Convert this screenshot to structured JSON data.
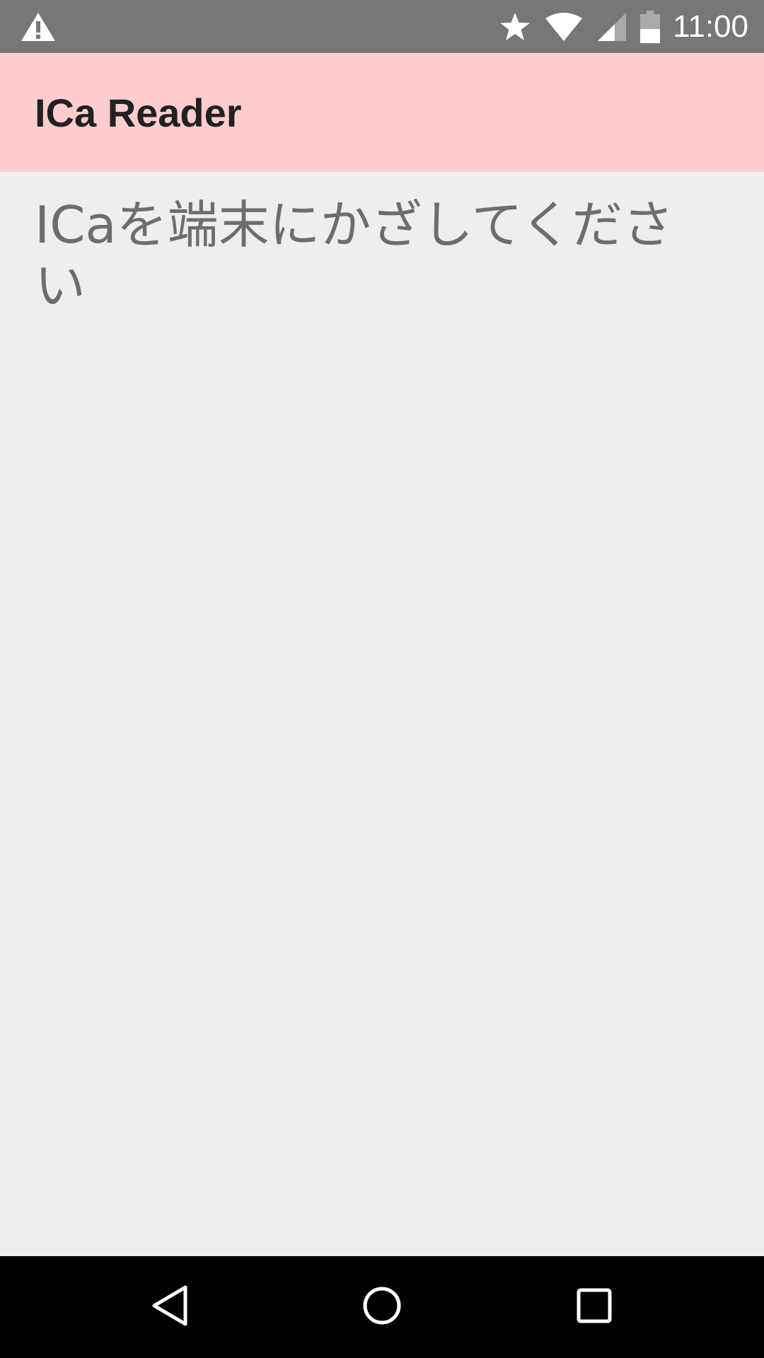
{
  "status_bar": {
    "time": "11:00",
    "icons": [
      "warning-icon",
      "star-icon",
      "wifi-icon",
      "cell-signal-icon",
      "battery-icon"
    ]
  },
  "app_bar": {
    "title": "ICa Reader",
    "background_color": "#ffcdd0"
  },
  "main": {
    "message": "ICaを端末にかざしてください"
  },
  "nav_bar": {
    "buttons": [
      "back-icon",
      "home-icon",
      "recents-icon"
    ]
  }
}
